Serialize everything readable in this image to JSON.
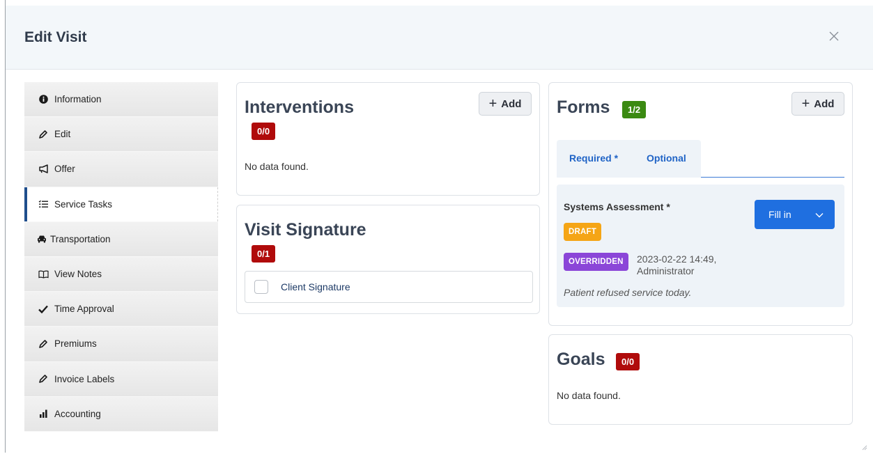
{
  "modal": {
    "title": "Edit Visit"
  },
  "sidebar": {
    "items": [
      {
        "label": "Information",
        "icon": "info-circle-icon",
        "active": false
      },
      {
        "label": "Edit",
        "icon": "pencil-icon",
        "active": false
      },
      {
        "label": "Offer",
        "icon": "megaphone-icon",
        "active": false
      },
      {
        "label": "Service Tasks",
        "icon": "task-list-icon",
        "active": true
      },
      {
        "label": "Transportation",
        "icon": "car-icon",
        "active": false
      },
      {
        "label": "View Notes",
        "icon": "book-icon",
        "active": false
      },
      {
        "label": "Time Approval",
        "icon": "checkmark-icon",
        "active": false
      },
      {
        "label": "Premiums",
        "icon": "pencil-icon",
        "active": false
      },
      {
        "label": "Invoice Labels",
        "icon": "pencil-icon",
        "active": false
      },
      {
        "label": "Accounting",
        "icon": "bar-chart-icon",
        "active": false
      }
    ]
  },
  "interventions": {
    "title": "Interventions",
    "count": "0/0",
    "add_label": "Add",
    "empty_text": "No data found."
  },
  "visit_signature": {
    "title": "Visit Signature",
    "count": "0/1",
    "item_label": "Client Signature",
    "item_checked": false
  },
  "forms": {
    "title": "Forms",
    "count": "1/2",
    "add_label": "Add",
    "tabs": [
      {
        "label": "Required *",
        "active": true
      },
      {
        "label": "Optional",
        "active": false
      }
    ],
    "item": {
      "name": "Systems Assessment *",
      "fill_label": "Fill in",
      "status": "DRAFT",
      "override_badge": "OVERRIDDEN",
      "override_date": "2023-02-22 14:49,",
      "override_by": "Administrator",
      "note": "Patient refused service today."
    }
  },
  "goals": {
    "title": "Goals",
    "count": "0/0",
    "empty_text": "No data found."
  },
  "colors": {
    "header_bg": "#f3f7fa",
    "badge_red": "#b00b0b",
    "badge_green": "#3b8a12",
    "primary_blue": "#1f6fe0",
    "draft_orange": "#f5a516",
    "overridden_purple": "#8b46d8",
    "active_indicator": "#1f4e8c"
  }
}
